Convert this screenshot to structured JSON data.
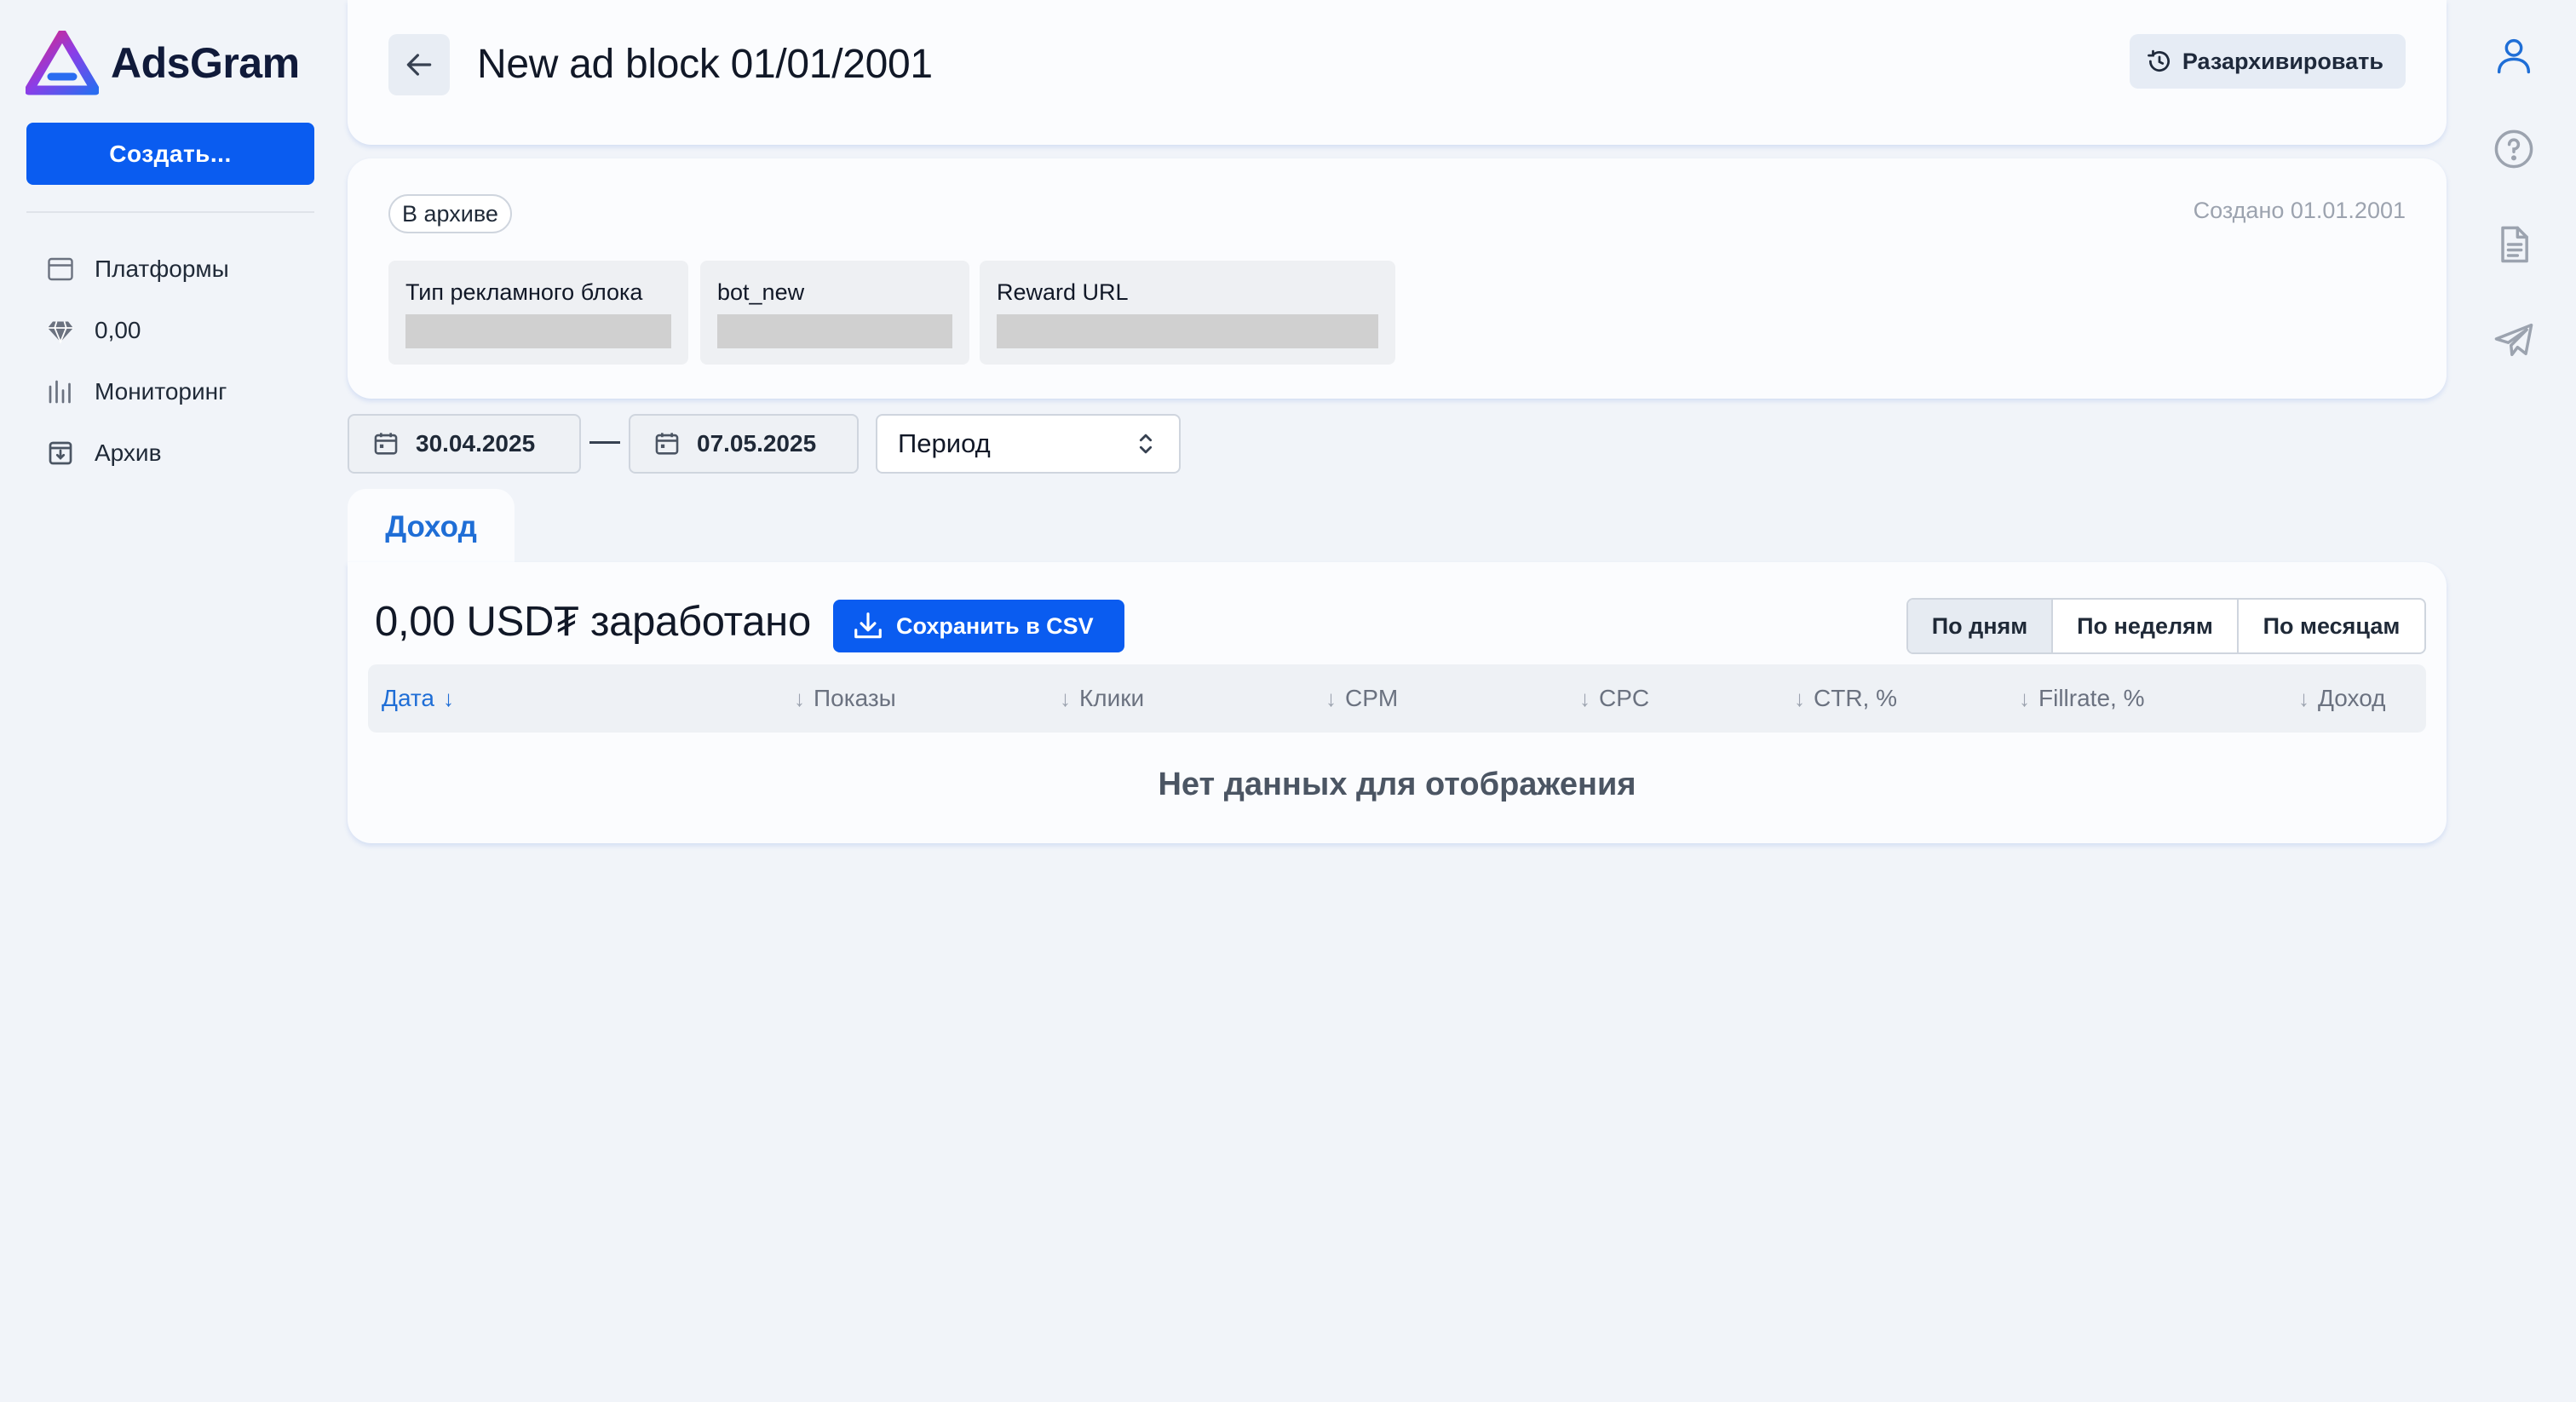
{
  "brand": {
    "name": "AdsGram"
  },
  "sidebar": {
    "create_label": "Создать...",
    "items": [
      {
        "label": "Платформы",
        "icon": "calendar-icon"
      },
      {
        "label": "0,00",
        "icon": "diamond-icon"
      },
      {
        "label": "Мониторинг",
        "icon": "bar-chart-icon"
      },
      {
        "label": "Архив",
        "icon": "archive-icon"
      }
    ]
  },
  "header": {
    "title": "New ad block 01/01/2001",
    "unarchive_label": "Разархивировать"
  },
  "info": {
    "status": "В архиве",
    "created": "Создано 01.01.2001",
    "fields": [
      {
        "label": "Тип рекламного блока"
      },
      {
        "label": "bot_new"
      },
      {
        "label": "Reward URL"
      }
    ]
  },
  "filters": {
    "date_from": "30.04.2025",
    "date_to": "07.05.2025",
    "period_label": "Период"
  },
  "tabs": [
    {
      "label": "Доход",
      "active": true
    }
  ],
  "stats": {
    "earned": "0,00 USD₮ заработано",
    "csv_label": "Сохранить в CSV",
    "group_by": [
      "По дням",
      "По неделям",
      "По месяцам"
    ],
    "group_selected": "По дням",
    "columns": [
      "Дата",
      "Показы",
      "Клики",
      "CPM",
      "CPC",
      "CTR, %",
      "Fillrate, %",
      "Доход"
    ],
    "empty_text": "Нет данных для отображения"
  },
  "colors": {
    "accent": "#0a5cf0",
    "link": "#1f6ed6",
    "background": "#f1f4f9"
  }
}
